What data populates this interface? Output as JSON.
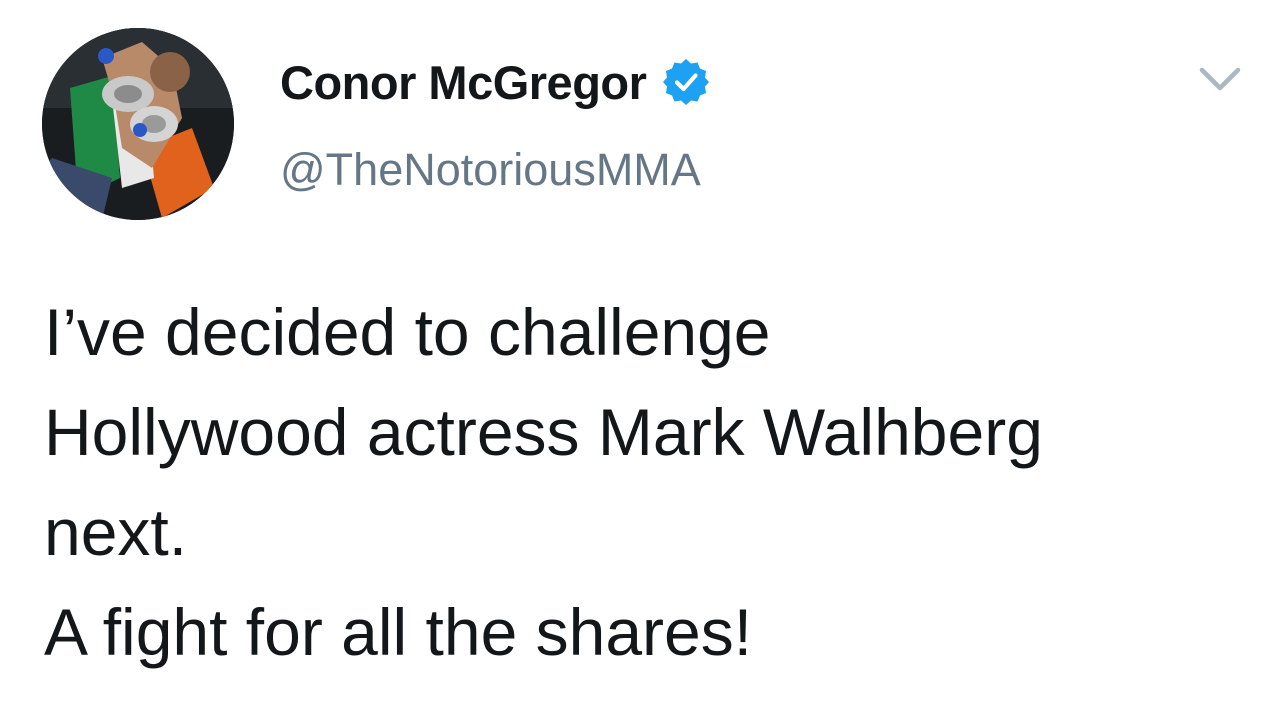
{
  "tweet": {
    "author": {
      "display_name": "Conor McGregor",
      "handle": "@TheNotoriousMMA",
      "verified": true,
      "verified_icon": "verified-badge-icon",
      "avatar_icon": "profile-avatar"
    },
    "menu_icon": "chevron-down-icon",
    "text_lines": [
      "I’ve decided to challenge",
      "Hollywood actress Mark Walhberg",
      "next.",
      "A fight for all the shares!"
    ]
  },
  "colors": {
    "text": "#14171a",
    "secondary_text": "#657786",
    "verified_blue": "#1da1f2",
    "caret": "#aab8c2",
    "background": "#ffffff"
  }
}
